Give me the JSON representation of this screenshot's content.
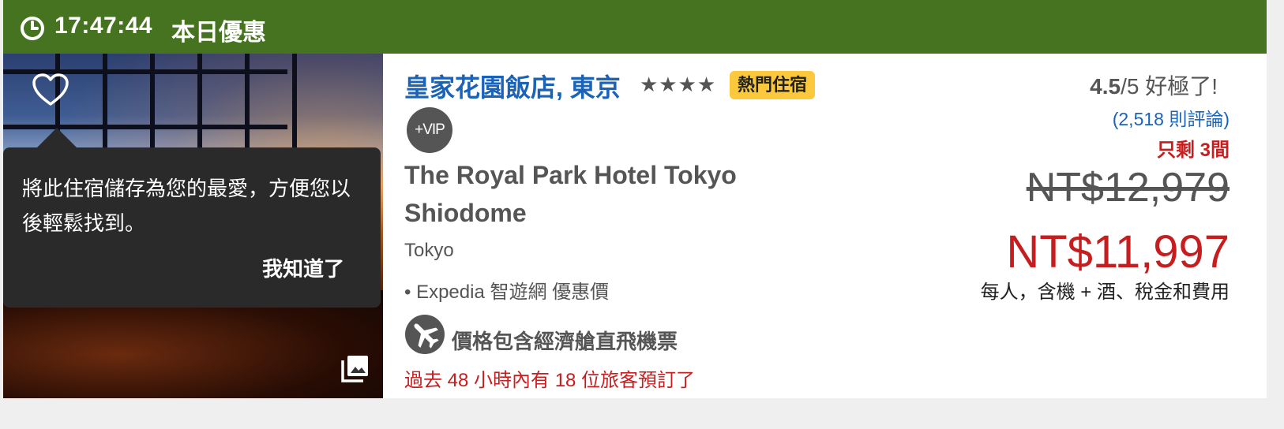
{
  "deal_bar": {
    "time": "17:47:44",
    "label": "本日優惠",
    "color": "#467320",
    "icon": "clock-icon"
  },
  "photo": {
    "favorite_icon": "heart-icon",
    "gallery_icon": "gallery-icon"
  },
  "tooltip": {
    "text": "將此住宿儲存為您的最愛，方便您以後輕鬆找到。",
    "button": "我知道了"
  },
  "hotel": {
    "name": "皇家花園飯店, 東京",
    "stars": "★★★★",
    "star_rating": 4,
    "badge": "熱門住宿",
    "vip": "+VIP",
    "name_en": "The Royal Park Hotel Tokyo Shiodome",
    "city": "Tokyo",
    "partner": "• Expedia 智遊網 優惠價",
    "flight_note": "價格包含經濟艙直飛機票",
    "booked_note": "過去 48 小時內有 18 位旅客預訂了"
  },
  "pricing": {
    "rating_score": "4.5",
    "rating_suffix": "/5 好極了!",
    "reviews": "(2,518 則評論)",
    "rooms_left": "只剩 3間",
    "old_price": "NT$12,979",
    "new_price": "NT$11,997",
    "price_note": "每人，含機 + 酒、稅金和費用"
  },
  "colors": {
    "link_blue": "#1a63b8",
    "alert_red": "#c61e1e",
    "badge_yellow": "#fcc93c"
  }
}
